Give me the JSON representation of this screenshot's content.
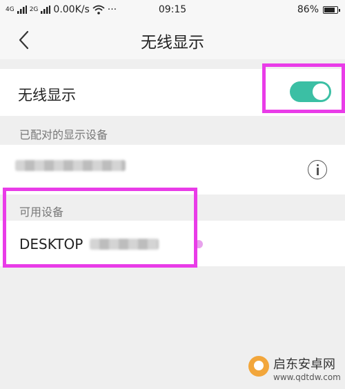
{
  "status_bar": {
    "network_1": "4G",
    "network_2": "2G",
    "speed": "0.00K/s",
    "more": "···",
    "time": "09:15",
    "battery_text": "86%",
    "battery_level": 0.86
  },
  "nav": {
    "title": "无线显示"
  },
  "wireless_display": {
    "label": "无线显示",
    "enabled": true
  },
  "paired_section": {
    "header": "已配对的显示设备"
  },
  "available_section": {
    "header": "可用设备",
    "device_name": "DESKTOP"
  },
  "colors": {
    "toggle_on": "#3bbfa4",
    "highlight": "#e93ce8",
    "background": "#efefef"
  },
  "watermark": {
    "title": "启东安卓网",
    "url": "www.qdtdw.com"
  }
}
